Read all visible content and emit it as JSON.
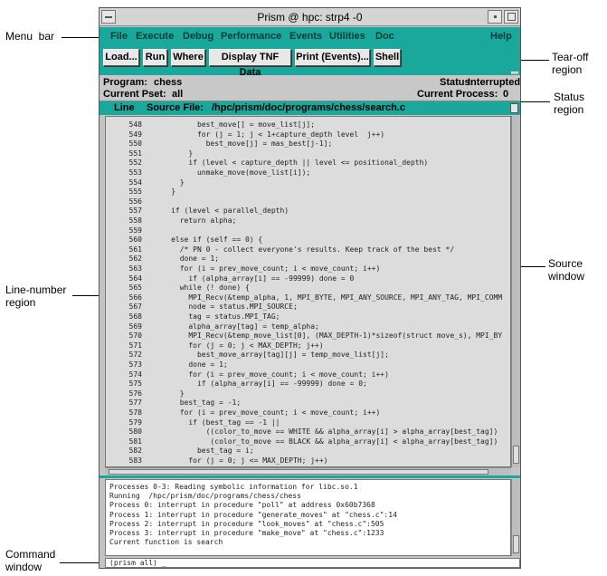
{
  "callouts": {
    "menu_bar": "Menu  bar",
    "tear_off": "Tear-off\nregion",
    "status_region": "Status\nregion",
    "source_window": "Source\nwindow",
    "line_number": "Line-number\nregion",
    "command_window": "Command\nwindow"
  },
  "window": {
    "title": "Prism @ hpc: strp4 -0"
  },
  "menu": {
    "items": [
      "File",
      "Execute",
      "Debug",
      "Performance",
      "Events",
      "Utilities",
      "Doc"
    ],
    "help": "Help"
  },
  "toolbar": {
    "buttons": [
      "Load...",
      "Run",
      "Where",
      "Display TNF Data",
      "Print (Events)...",
      "Shell"
    ]
  },
  "status": {
    "program_label": "Program:",
    "program_value": "chess",
    "status_label": "Status:",
    "status_value": "Interrupted",
    "pset_label": "Current Pset:",
    "pset_value": "all",
    "process_label": "Current Process:",
    "process_value": "0"
  },
  "source": {
    "line_header": "Line",
    "file_label": "Source File:",
    "file_path": "/hpc/prism/doc/programs/chess/search.c",
    "lines": [
      {
        "n": "548",
        "code": "           best_move[] = move_list[j];"
      },
      {
        "n": "549",
        "code": "           for (j = 1; j < 1+capture_depth level  j++)"
      },
      {
        "n": "550",
        "code": "             best_move[j] = mas_best[j-1];"
      },
      {
        "n": "551",
        "code": "         }"
      },
      {
        "n": "552",
        "code": "         if (level < capture_depth || level <= positional_depth)"
      },
      {
        "n": "553",
        "code": "           unmake_move(move_list[i]);"
      },
      {
        "n": "554",
        "code": "       }"
      },
      {
        "n": "555",
        "code": "     }"
      },
      {
        "n": "556",
        "code": ""
      },
      {
        "n": "557",
        "code": "     if (level < parallel_depth)"
      },
      {
        "n": "558",
        "code": "       return alpha;"
      },
      {
        "n": "559",
        "code": ""
      },
      {
        "n": "560",
        "code": "     else if (self == 0) {"
      },
      {
        "n": "561",
        "code": "       /* PN 0 - collect everyone's results. Keep track of the best */"
      },
      {
        "n": "562",
        "code": "       done = 1;"
      },
      {
        "n": "563",
        "code": "       for (i = prev_move_count; i < move_count; i++)"
      },
      {
        "n": "564",
        "code": "         if (alpha_array[i] == -99999) done = 0"
      },
      {
        "n": "565",
        "code": "       while (! done) {"
      },
      {
        "n": "566",
        "code": "         MPI_Recv(&temp_alpha, 1, MPI_BYTE, MPI_ANY_SOURCE, MPI_ANY_TAG, MPI_COMM"
      },
      {
        "n": "567",
        "code": "         node = status.MPI_SOURCE;"
      },
      {
        "n": "568",
        "code": "         tag = status.MPI_TAG;"
      },
      {
        "n": "569",
        "code": "         alpha_array[tag] = temp_alpha;"
      },
      {
        "n": "570",
        "code": "         MPI_Recv(&temp_move_list[0], (MAX_DEPTH-1)*sizeof(struct move_s), MPI_BY"
      },
      {
        "n": "571",
        "code": "         for (j = 0; j < MAX_DEPTH; j++)"
      },
      {
        "n": "572",
        "code": "           best_move_array[tag][j] = temp_move_list[j];"
      },
      {
        "n": "573",
        "code": "         done = 1;"
      },
      {
        "n": "574",
        "code": "         for (i = prev_move_count; i < move_count; i++)"
      },
      {
        "n": "575",
        "code": "           if (alpha_array[i] == -99999) done = 0;"
      },
      {
        "n": "576",
        "code": "       }"
      },
      {
        "n": "577",
        "code": "       best_tag = -1;"
      },
      {
        "n": "578",
        "code": "       for (i = prev_move_count; i < move_count; i++)"
      },
      {
        "n": "579",
        "code": "         if (best_tag == -1 ||"
      },
      {
        "n": "580",
        "code": "             ((color_to_move == WHITE && alpha_array[i] > alpha_array[best_tag])"
      },
      {
        "n": "581",
        "code": "              (color_to_move == BLACK && alpha_array[i] < alpha_array[best_tag])"
      },
      {
        "n": "582",
        "code": "           best_tag = i;"
      },
      {
        "n": "583",
        "code": "         for (j = 0; j <= MAX_DEPTH; j++)"
      }
    ]
  },
  "command": {
    "output": [
      "Processes 0-3: Reading symbolic information for libc.so.1",
      "Running  /hpc/prism/doc/programs/chess/chess",
      "Process 0: interrupt in procedure \"poll\" at address 0x60b7368",
      "Process 1: interrupt in procedure \"generate_moves\" at \"chess.c\":14",
      "Process 2: interrupt in procedure \"look_moves\" at \"chess.c\":505",
      "Process 3: interrupt in procedure \"make_move\" at \"chess.c\":1233",
      "Current function is search"
    ],
    "prompt": "(prism all) _"
  }
}
